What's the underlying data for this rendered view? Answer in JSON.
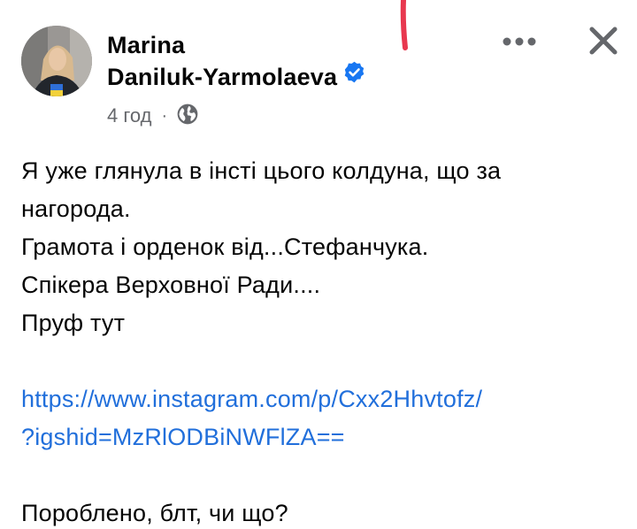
{
  "header": {
    "author_line1": "Marina",
    "author_line2": "Daniluk-Yarmolaeva",
    "time": "4 год",
    "separator": "·",
    "verified_icon": "verified-badge-icon",
    "audience_icon": "globe-icon"
  },
  "actions": {
    "more_icon": "more-options-icon",
    "close_icon": "close-icon"
  },
  "post": {
    "lines": [
      "Я уже глянула в інсті цього колдуна, що за",
      "нагорода.",
      "Грамота і орденок від...Стефанчука.",
      "Спікера Верховної Ради....",
      "Пруф тут"
    ],
    "link_line1": "https://www.instagram.com/p/Cxx2Hhvtofz/",
    "link_line2": "?igshid=MzRlODBiNWFlZA==",
    "closing": "Пороблено, блт, чи що?"
  },
  "colors": {
    "text": "#050505",
    "secondary": "#65676b",
    "link": "#216fdb",
    "verified": "#1877f2",
    "mark": "#e8384f"
  }
}
